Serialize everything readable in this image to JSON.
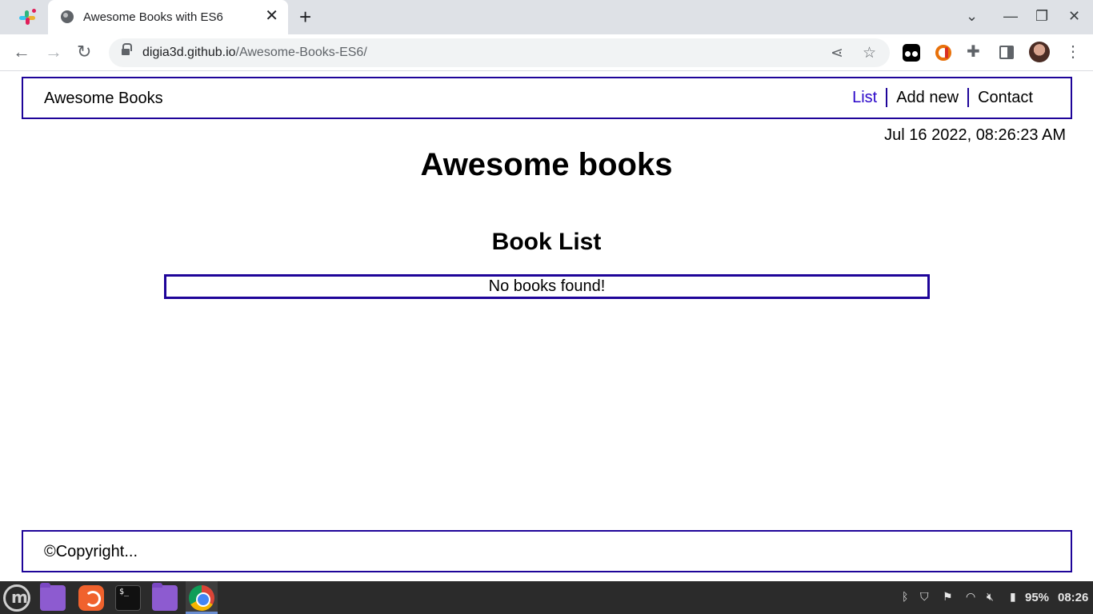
{
  "browser": {
    "tab_title": "Awesome Books with ES6",
    "url_domain": "digia3d.github.io",
    "url_path": "/Awesome-Books-ES6/"
  },
  "page": {
    "brand": "Awesome Books",
    "nav": {
      "list": "List",
      "add_new": "Add new",
      "contact": "Contact"
    },
    "datetime": "Jul 16 2022, 08:26:23 AM",
    "title": "Awesome books",
    "section_title": "Book List",
    "empty_message": "No books found!",
    "footer": "©Copyright..."
  },
  "taskbar": {
    "battery": "95%",
    "clock": "08:26"
  },
  "colors": {
    "accent_border": "#1e0499",
    "active_link": "#2a06c9"
  }
}
